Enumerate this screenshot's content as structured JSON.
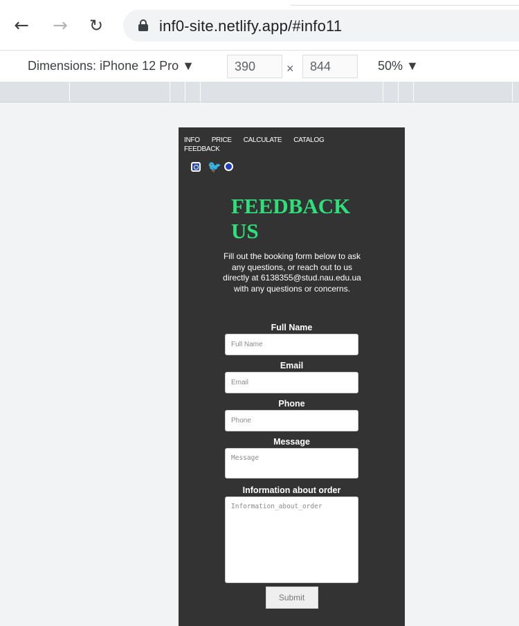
{
  "browser": {
    "back_glyph": "←",
    "forward_glyph": "→",
    "reload_glyph": "↻",
    "url": "inf0-site.netlify.app/#info11"
  },
  "devtools": {
    "dimensions_label": "Dimensions: iPhone 12 Pro ▼",
    "width": "390",
    "times": "×",
    "height": "844",
    "zoom": "50% ▼"
  },
  "site": {
    "nav": [
      "INFO",
      "PRICE",
      "CALCULATE",
      "CATALOG",
      "FEEDBACK"
    ],
    "social_icons": [
      "instagram-icon",
      "twitter-icon",
      "telegram-icon"
    ],
    "twitter_glyph": "🐦",
    "title": "FEEDBACK US",
    "title_color": "#2fe07a",
    "background_color": "#333333",
    "intro": "Fill out the booking form below to ask any questions, or reach out to us directly at 6138355@stud.nau.edu.ua with any questions or concerns.",
    "form": {
      "full_name_label": "Full Name",
      "full_name_placeholder": "Full Name",
      "email_label": "Email",
      "email_placeholder": "Email",
      "phone_label": "Phone",
      "phone_placeholder": "Phone",
      "message_label": "Message",
      "message_placeholder": "Message",
      "order_label": "Information about order",
      "order_placeholder": "Information_about_order",
      "submit_label": "Submit"
    }
  }
}
